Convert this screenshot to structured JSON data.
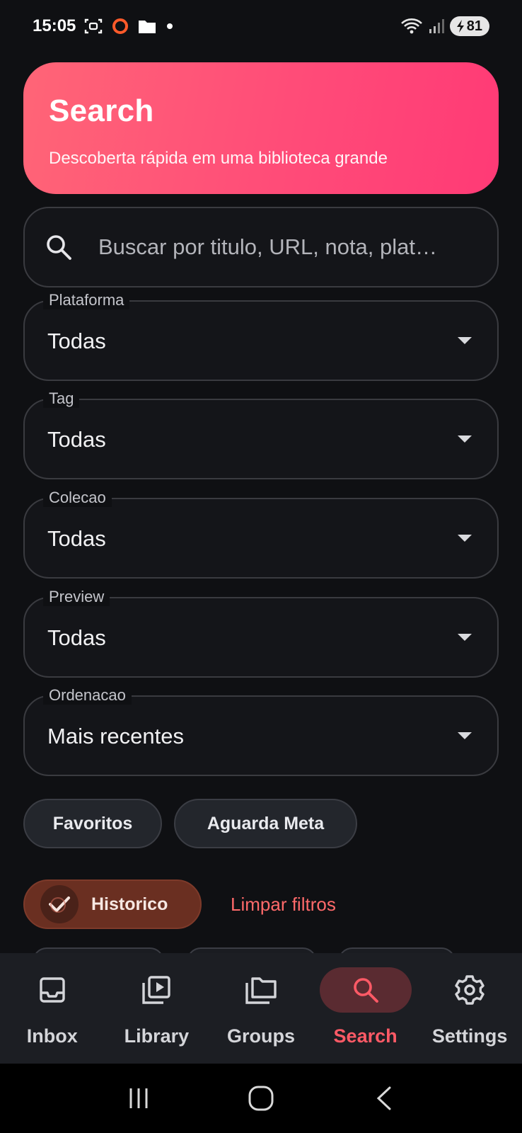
{
  "status_bar": {
    "time": "15:05",
    "battery": "81",
    "icons": [
      "screenshot-icon",
      "record-icon",
      "folder-icon",
      "dot-icon",
      "wifi-icon",
      "signal-icon",
      "battery-icon"
    ]
  },
  "header": {
    "title": "Search",
    "subtitle": "Descoberta rápida em uma biblioteca grande",
    "gradient": [
      "#ff6577",
      "#ff3a76"
    ]
  },
  "search": {
    "placeholder": "Buscar por titulo, URL, nota, plat…",
    "value": ""
  },
  "filters": [
    {
      "label": "Plataforma",
      "value": "Todas"
    },
    {
      "label": "Tag",
      "value": "Todas"
    },
    {
      "label": "Colecao",
      "value": "Todas"
    },
    {
      "label": "Preview",
      "value": "Todas"
    },
    {
      "label": "Ordenacao",
      "value": "Mais recentes"
    }
  ],
  "chips": {
    "favoritos": "Favoritos",
    "aguarda_meta": "Aguarda Meta",
    "historico": "Historico",
    "clear_filters": "Limpar filtros"
  },
  "bottom_nav": {
    "items": [
      {
        "label": "Inbox",
        "icon": "inbox-icon"
      },
      {
        "label": "Library",
        "icon": "library-icon"
      },
      {
        "label": "Groups",
        "icon": "folders-icon"
      },
      {
        "label": "Search",
        "icon": "search-icon"
      },
      {
        "label": "Settings",
        "icon": "gear-icon"
      }
    ],
    "active": "Search"
  },
  "colors": {
    "accent": "#ff5a66",
    "background": "#0f1013",
    "selected_chip": "#6a2f21"
  }
}
